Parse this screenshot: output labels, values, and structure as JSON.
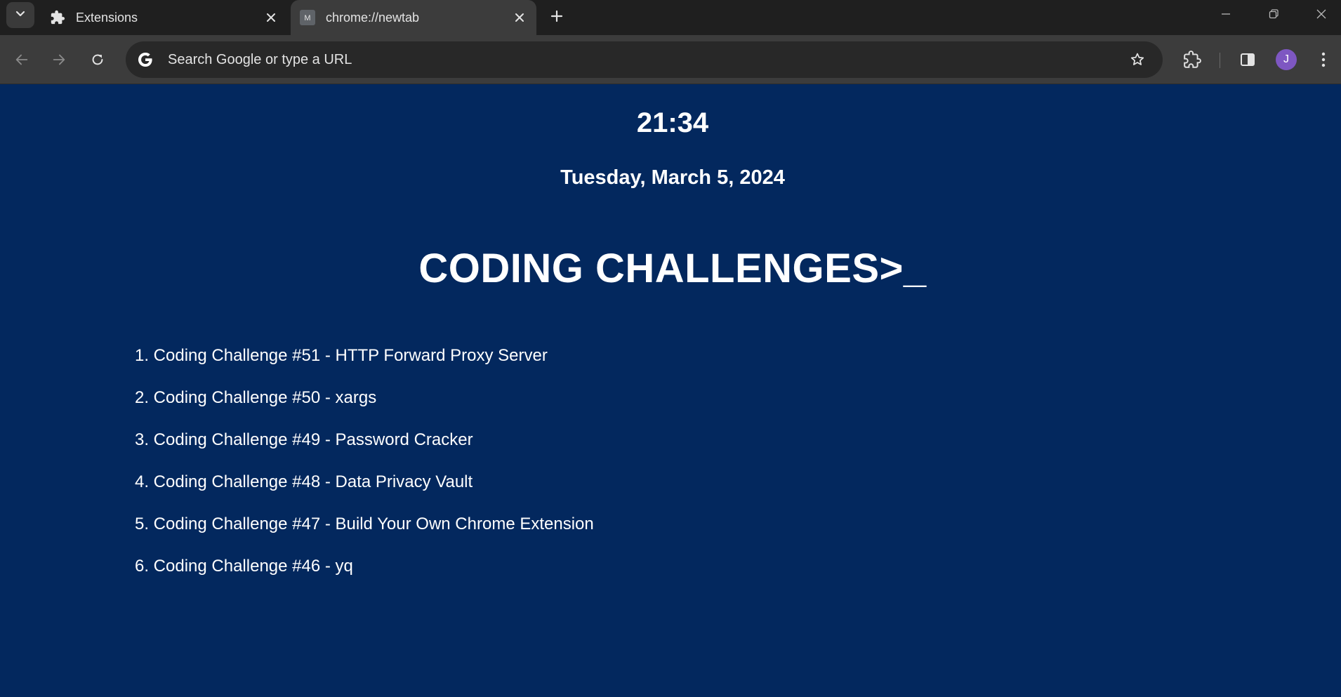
{
  "browser": {
    "tabs": [
      {
        "title": "Extensions",
        "icon": "puzzle-icon",
        "active": false
      },
      {
        "title": "chrome://newtab",
        "icon": "m-favicon-icon",
        "favicon_letter": "M",
        "active": true
      }
    ],
    "omnibox": {
      "placeholder": "Search Google or type a URL",
      "value": ""
    },
    "profile_initial": "J",
    "colors": {
      "tabstrip": "#1f1f1f",
      "toolbar": "#3c3c3c",
      "omnibox": "#282828",
      "avatar": "#7e57c2"
    }
  },
  "page": {
    "time": "21:34",
    "date": "Tuesday, March 5, 2024",
    "heading": "CODING CHALLENGES>_",
    "background": "#03285e",
    "challenges": [
      "1. Coding Challenge #51 - HTTP Forward Proxy Server",
      "2. Coding Challenge #50 - xargs",
      "3. Coding Challenge #49 - Password Cracker",
      "4. Coding Challenge #48 - Data Privacy Vault",
      "5. Coding Challenge #47 - Build Your Own Chrome Extension",
      "6. Coding Challenge #46 - yq"
    ]
  }
}
